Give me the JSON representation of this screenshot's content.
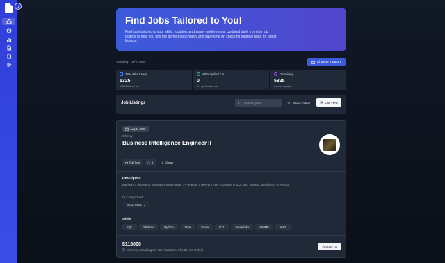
{
  "sidebar": {
    "items": [
      {
        "icon": "home-icon",
        "active": true
      },
      {
        "icon": "clock-icon",
        "active": false
      },
      {
        "icon": "bar-chart-icon",
        "active": false
      },
      {
        "icon": "document-icon",
        "active": false
      },
      {
        "icon": "file-icon",
        "active": false
      },
      {
        "icon": "gear-icon",
        "active": false
      }
    ]
  },
  "hero": {
    "title": "Find Jobs Tailored to You!",
    "description": "Find jobs tailored to your skills, location, and salary preferences. Updated daily from top job boards to help you find the perfect opportunity and save time on checking multiple sites for latest listings."
  },
  "industry": {
    "viewing_label": "Viewing: Tech Jobs",
    "change_button": "Change Industry"
  },
  "stats": [
    {
      "label": "Total Jobs Found",
      "value": "5325",
      "sub": "#1644 filtered out",
      "color": "#3b82f6"
    },
    {
      "label": "Jobs Applied For",
      "value": "0",
      "sub": "0% application rate",
      "color": "#22c55e"
    },
    {
      "label": "Remaining",
      "value": "5325",
      "sub": "Jobs to apply for",
      "color": "#a855f7"
    }
  ],
  "listings": {
    "title": "Job Listings",
    "search_placeholder": "Search jobs...",
    "filters_label": "Show Filters",
    "view_label": "List View"
  },
  "job": {
    "date": "Aug 1, 2025",
    "company": "Chewy",
    "title": "Business Intelligence Engineer II",
    "tags": [
      "Full Time",
      "1",
      "Chewy"
    ],
    "description_label": "Description",
    "description": "Bachelor's degree or equivalent experience, 3+ years in a relevant role, expertise in SQL and Tableau, proficiency in Python.",
    "description_more": "&nbsp;\nOur Opportunit...",
    "show_more_label": "Show More",
    "skills_label": "Skills",
    "skills": [
      "SQL",
      "Tableau",
      "Python",
      "Java",
      "Scala",
      "ETL",
      "Snowflake",
      "KNIME",
      "AWS"
    ],
    "salary": "$113000",
    "location": "Bellevue, Washington, US,Plantation, Florida, US Hybrid",
    "actions_label": "Actions"
  }
}
